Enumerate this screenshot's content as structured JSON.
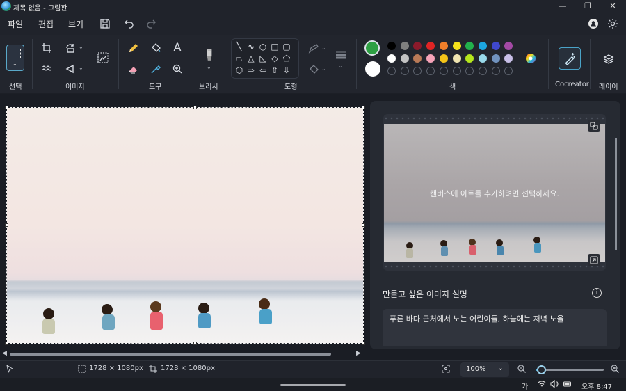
{
  "window": {
    "title": "제목 없음 - 그림판",
    "min": "—",
    "restore": "❐",
    "close": "✕"
  },
  "menu": {
    "file": "파일",
    "edit": "편집",
    "view": "보기"
  },
  "ribbon": {
    "groups": {
      "selection": "선택",
      "image": "이미지",
      "tools": "도구",
      "brushes": "브러시",
      "shapes": "도형",
      "colors": "색",
      "cocreator": "Cocreator",
      "layers": "레이어"
    },
    "primary_color": "#2ea043",
    "secondary_color": "#ffffff",
    "palette_row1": [
      "#000000",
      "#7f7f7f",
      "#8b1a2b",
      "#e02424",
      "#f07f2a",
      "#f5e11b",
      "#22b14c",
      "#1ca6e0",
      "#3f48cc",
      "#a349a4"
    ],
    "palette_row2": [
      "#ffffff",
      "#c3c3c3",
      "#b97a57",
      "#f5a3b8",
      "#f5c518",
      "#efe4b0",
      "#b5e61d",
      "#99d9ea",
      "#7092be",
      "#c8bfe7"
    ],
    "palette_row3_empty": 10
  },
  "status": {
    "selection_size": "1728 × 1080px",
    "canvas_size": "1728 × 1080px",
    "zoom": "100%",
    "zoom_level_fraction": 0.08
  },
  "cocreator_panel": {
    "preview_hint": "캔버스에 아트를 추가하려면 선택하세요.",
    "description_title": "만들고 싶은 이미지 설명",
    "prompt": "푸른 바다 근처에서 노는 어린이들, 하늘에는 저녁 노을"
  },
  "taskbar": {
    "ime": "가",
    "clock": "오후 8:47"
  }
}
